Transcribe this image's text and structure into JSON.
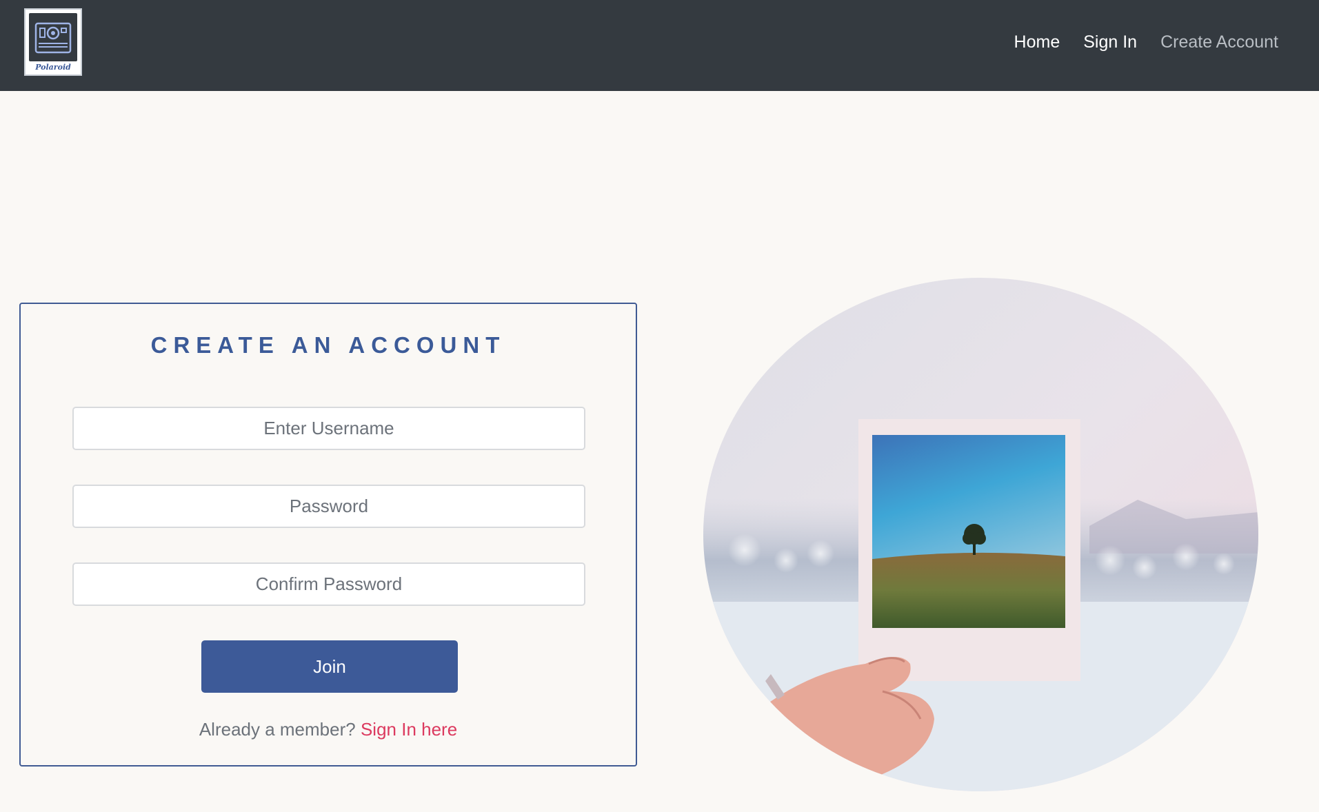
{
  "nav": {
    "logo_text": "Polaroid",
    "links": [
      {
        "label": "Home"
      },
      {
        "label": "Sign In"
      },
      {
        "label": "Create Account"
      }
    ]
  },
  "form": {
    "title": "CREATE AN ACCOUNT",
    "fields": {
      "username": {
        "placeholder": "Enter Username",
        "value": ""
      },
      "password": {
        "placeholder": "Password",
        "value": ""
      },
      "confirm_password": {
        "placeholder": "Confirm Password",
        "value": ""
      }
    },
    "submit_label": "Join",
    "member_prompt": "Already a member?",
    "signin_link": "Sign In here"
  },
  "colors": {
    "navbar": "#343a40",
    "primary": "#3d5a98",
    "link_accent": "#dc3a5f",
    "page_background": "#faf8f5"
  },
  "icons": {
    "logo": "polaroid-camera-icon"
  }
}
